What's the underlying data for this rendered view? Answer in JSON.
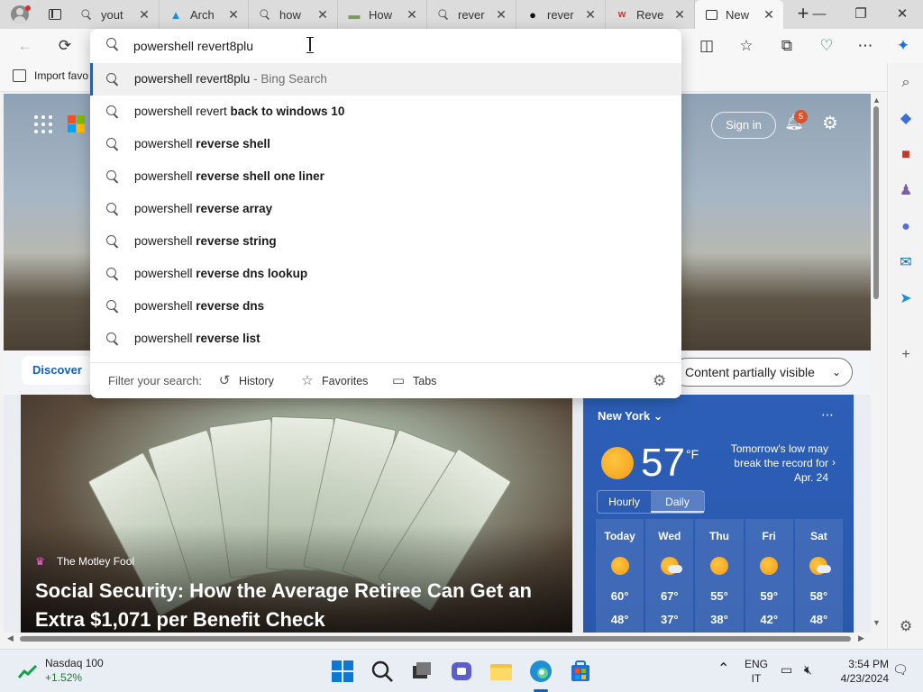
{
  "tabs": [
    {
      "label": "yout",
      "icon": "search-icon"
    },
    {
      "label": "Arch",
      "icon": "arch-icon"
    },
    {
      "label": "how",
      "icon": "search-icon"
    },
    {
      "label": "How",
      "icon": "page-icon"
    },
    {
      "label": "rever",
      "icon": "search-icon"
    },
    {
      "label": "rever",
      "icon": "github-icon"
    },
    {
      "label": "Reve",
      "icon": "w-icon"
    },
    {
      "label": "New",
      "icon": "newtab-icon",
      "active": true
    }
  ],
  "address": {
    "value": "powershell revert8plu"
  },
  "favorites_bar": {
    "import_label": "Import favo"
  },
  "suggestions": [
    {
      "plain": "powershell revert8plu",
      "bold": "",
      "sub": " - Bing Search"
    },
    {
      "plain": "powershell revert ",
      "bold": "back to windows 10",
      "sub": ""
    },
    {
      "plain": "powershell ",
      "bold": "reverse shell",
      "sub": ""
    },
    {
      "plain": "powershell ",
      "bold": "reverse shell one liner",
      "sub": ""
    },
    {
      "plain": "powershell ",
      "bold": "reverse array",
      "sub": ""
    },
    {
      "plain": "powershell ",
      "bold": "reverse string",
      "sub": ""
    },
    {
      "plain": "powershell ",
      "bold": "reverse dns lookup",
      "sub": ""
    },
    {
      "plain": "powershell ",
      "bold": "reverse dns",
      "sub": ""
    },
    {
      "plain": "powershell ",
      "bold": "reverse list",
      "sub": ""
    }
  ],
  "filter": {
    "label": "Filter your search:",
    "history": "History",
    "favorites": "Favorites",
    "tabs": "Tabs"
  },
  "newtab": {
    "sign_in": "Sign in",
    "notifications": "5",
    "discover": "Discover",
    "content_visibility": "Content partially visible"
  },
  "news": {
    "source": "The Motley Fool",
    "headline": "Social Security: How the Average Retiree Can Get an Extra $1,071 per Benefit Check"
  },
  "weather": {
    "location": "New York",
    "temp": "57",
    "unit": "°F",
    "note": "Tomorrow's low may break the record for Apr. 24",
    "tab_hourly": "Hourly",
    "tab_daily": "Daily",
    "days": [
      {
        "name": "Today",
        "high": "60°",
        "low": "48°",
        "icon": "sunny"
      },
      {
        "name": "Wed",
        "high": "67°",
        "low": "37°",
        "icon": "partly-cloudy"
      },
      {
        "name": "Thu",
        "high": "55°",
        "low": "38°",
        "icon": "sunny"
      },
      {
        "name": "Fri",
        "high": "59°",
        "low": "42°",
        "icon": "sunny"
      },
      {
        "name": "Sat",
        "high": "58°",
        "low": "48°",
        "icon": "partly-cloudy"
      }
    ]
  },
  "taskbar": {
    "stock_name": "Nasdaq 100",
    "stock_change": "+1.52%",
    "lang1": "ENG",
    "lang2": "IT",
    "time": "3:54 PM",
    "date": "4/23/2024"
  },
  "colors": {
    "accent": "#2a5ea8",
    "discover": "#0f5fbf",
    "weather_bg": "#2d5fb8",
    "notification_badge": "#d9532c",
    "stock_up": "#1a7d32"
  }
}
